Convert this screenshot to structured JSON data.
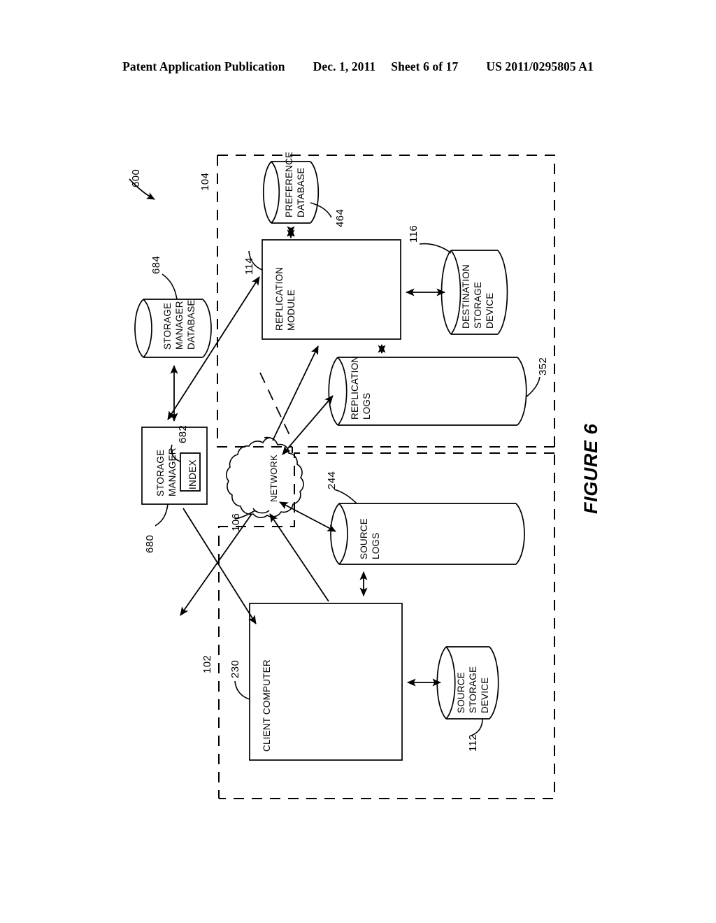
{
  "header": {
    "publication": "Patent Application Publication",
    "date": "Dec. 1, 2011",
    "sheet": "Sheet 6 of 17",
    "patent_number": "US 2011/0295805 A1"
  },
  "figure": {
    "title": "FIGURE 6",
    "system_ref": "600"
  },
  "nodes": {
    "storage_manager_database": {
      "label": "STORAGE\nMANAGER\nDATABASE",
      "ref": "684",
      "shape": "cylinder"
    },
    "storage_manager": {
      "label": "STORAGE\nMANAGER",
      "ref": "680",
      "shape": "box"
    },
    "index": {
      "label": "INDEX",
      "ref": "682",
      "shape": "box"
    },
    "preference_database": {
      "label": "PREFERENCE\nDATABASE",
      "ref": "464",
      "shape": "cylinder"
    },
    "replication_module": {
      "label": "REPLICATION\nMODULE",
      "ref": "114",
      "shape": "box"
    },
    "destination_storage_device": {
      "label": "DESTINATION\nSTORAGE\nDEVICE",
      "ref": "116",
      "shape": "cylinder"
    },
    "replication_logs": {
      "label": "REPLICATION\nLOGS",
      "ref": "352",
      "shape": "cylinder"
    },
    "network": {
      "label": "NETWORK",
      "ref": "106",
      "shape": "cloud"
    },
    "source_logs": {
      "label": "SOURCE\nLOGS",
      "ref": "244",
      "shape": "cylinder"
    },
    "client_computer": {
      "label": "CLIENT COMPUTER",
      "ref": "230",
      "shape": "box"
    },
    "source_storage_device": {
      "label": "SOURCE\nSTORAGE\nDEVICE",
      "ref": "112",
      "shape": "cylinder"
    }
  },
  "regions": {
    "destination_system": {
      "ref": "104",
      "style": "dashed"
    },
    "source_system": {
      "ref": "102",
      "style": "dashed"
    }
  },
  "labels": {
    "storage_manager_database_l1": "STORAGE",
    "storage_manager_database_l2": "MANAGER",
    "storage_manager_database_l3": "DATABASE",
    "storage_manager_l1": "STORAGE",
    "storage_manager_l2": "MANAGER",
    "index": "INDEX",
    "preference_database_l1": "PREFERENCE",
    "preference_database_l2": "DATABASE",
    "replication_module_l1": "REPLICATION",
    "replication_module_l2": "MODULE",
    "destination_storage_device_l1": "DESTINATION",
    "destination_storage_device_l2": "STORAGE",
    "destination_storage_device_l3": "DEVICE",
    "replication_logs_l1": "REPLICATION",
    "replication_logs_l2": "LOGS",
    "network": "NETWORK",
    "source_logs_l1": "SOURCE",
    "source_logs_l2": "LOGS",
    "client_computer": "CLIENT COMPUTER",
    "source_storage_device_l1": "SOURCE",
    "source_storage_device_l2": "STORAGE",
    "source_storage_device_l3": "DEVICE"
  },
  "refs": {
    "system": "600",
    "destination_region": "104",
    "source_region": "102",
    "storage_manager_database": "684",
    "storage_manager": "680",
    "index": "682",
    "preference_database": "464",
    "replication_module": "114",
    "destination_storage_device": "116",
    "replication_logs": "352",
    "network": "106",
    "source_logs": "244",
    "client_computer": "230",
    "source_storage_device": "112"
  },
  "colors": {
    "ink": "#000000",
    "paper": "#ffffff"
  }
}
